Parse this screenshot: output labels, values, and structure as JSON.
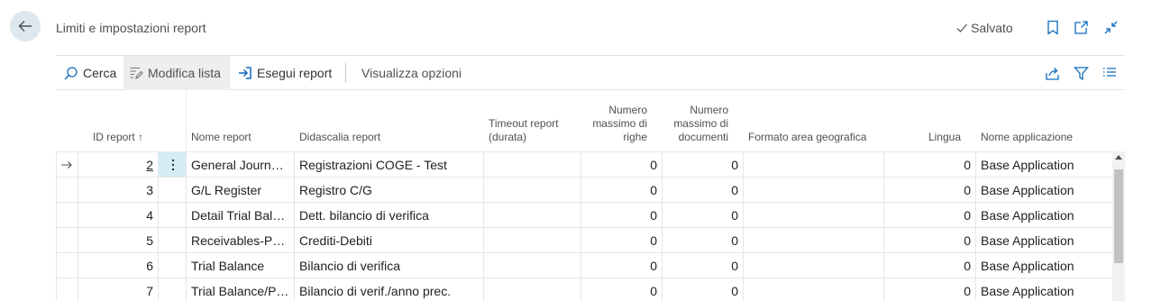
{
  "header": {
    "title": "Limiti e impostazioni report",
    "saved_label": "Salvato"
  },
  "toolbar": {
    "search_label": "Cerca",
    "edit_list_label": "Modifica lista",
    "run_report_label": "Esegui report",
    "view_options_label": "Visualizza opzioni"
  },
  "columns": {
    "report_id": "ID report",
    "sort_arrow": "↑",
    "report_name": "Nome report",
    "report_caption": "Didascalia report",
    "timeout_1": "Timeout report",
    "timeout_2": "(durata)",
    "max_rows_1": "Numero",
    "max_rows_2": "massimo di",
    "max_rows_3": "righe",
    "max_docs_1": "Numero",
    "max_docs_2": "massimo di",
    "max_docs_3": "documenti",
    "geo_format": "Formato area geografica",
    "language": "Lingua",
    "app_name": "Nome applicazione"
  },
  "rows": [
    {
      "id": "2",
      "name": "General Journal ...",
      "caption": "Registrazioni COGE - Test",
      "timeout": "",
      "max_rows": "0",
      "max_docs": "0",
      "geo": "",
      "lang": "0",
      "app": "Base Application"
    },
    {
      "id": "3",
      "name": "G/L Register",
      "caption": "Registro C/G",
      "timeout": "",
      "max_rows": "0",
      "max_docs": "0",
      "geo": "",
      "lang": "0",
      "app": "Base Application"
    },
    {
      "id": "4",
      "name": "Detail Trial Bala...",
      "caption": "Dett. bilancio di verifica",
      "timeout": "",
      "max_rows": "0",
      "max_docs": "0",
      "geo": "",
      "lang": "0",
      "app": "Base Application"
    },
    {
      "id": "5",
      "name": "Receivables-Pay...",
      "caption": "Crediti-Debiti",
      "timeout": "",
      "max_rows": "0",
      "max_docs": "0",
      "geo": "",
      "lang": "0",
      "app": "Base Application"
    },
    {
      "id": "6",
      "name": "Trial Balance",
      "caption": "Bilancio di verifica",
      "timeout": "",
      "max_rows": "0",
      "max_docs": "0",
      "geo": "",
      "lang": "0",
      "app": "Base Application"
    },
    {
      "id": "7",
      "name": "Trial Balance/Pr...",
      "caption": "Bilancio di verif./anno prec.",
      "timeout": "",
      "max_rows": "0",
      "max_docs": "0",
      "geo": "",
      "lang": "0",
      "app": "Base Application"
    }
  ],
  "icons": {
    "back": "back-arrow-icon",
    "bookmark": "bookmark-icon",
    "open_new": "open-new-window-icon",
    "collapse": "collapse-icon",
    "share": "share-icon",
    "filter": "filter-icon",
    "list": "list-icon"
  },
  "colors": {
    "accent": "#0f6cbd",
    "back_button_bg": "#dde7ee",
    "selected_row_marker_bg": "#d5eef5"
  }
}
